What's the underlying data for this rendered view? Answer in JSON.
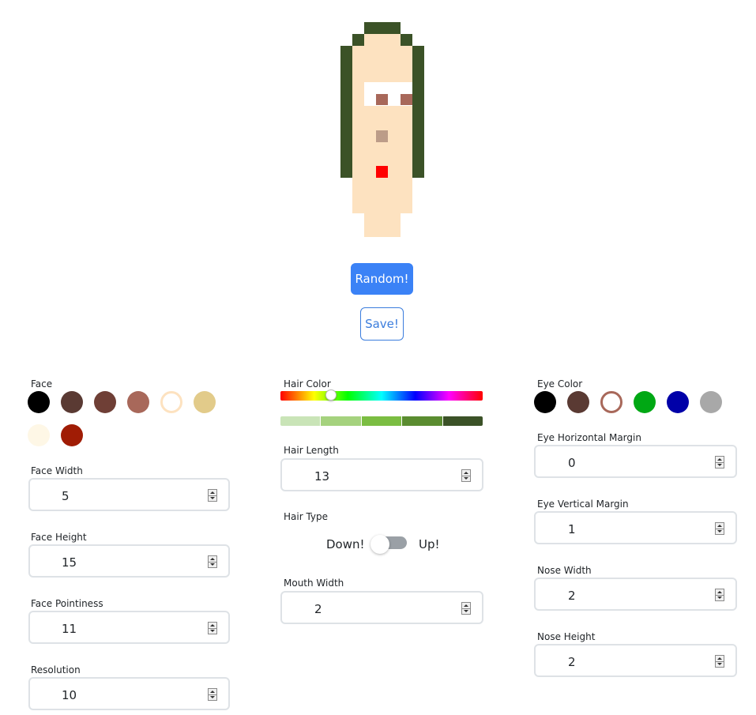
{
  "buttons": {
    "random_label": "Random!",
    "save_label": "Save!"
  },
  "face": {
    "label": "Face",
    "swatches": [
      "#000000",
      "#5a3a33",
      "#6f3f36",
      "#a8685a",
      "#fde2c0",
      "#e2cb8a",
      "#fef7e6",
      "#a01c05"
    ],
    "selected_swatch": "#fde2c0",
    "width": {
      "label": "Face Width",
      "value": "5"
    },
    "height": {
      "label": "Face Height",
      "value": "15"
    },
    "pointiness": {
      "label": "Face Pointiness",
      "value": "11"
    },
    "resolution": {
      "label": "Resolution",
      "value": "10"
    }
  },
  "hair": {
    "color_label": "Hair Color",
    "hue_level": 0.25,
    "shades": [
      "#c9e4b7",
      "#a5d27e",
      "#7bbd42",
      "#5a8c30",
      "#3b5227"
    ],
    "length": {
      "label": "Hair Length",
      "value": "13"
    },
    "type": {
      "label": "Hair Type",
      "off_label": "Down!",
      "on_label": "Up!",
      "is_up": false
    }
  },
  "mouth": {
    "width": {
      "label": "Mouth Width",
      "value": "2"
    }
  },
  "eye": {
    "color_label": "Eye Color",
    "swatches": [
      "#000000",
      "#5a3a33",
      "#a8685a",
      "#00a814",
      "#0000a8",
      "#a8a8a8"
    ],
    "selected_swatch": "#a8685a",
    "horizontal_margin": {
      "label": "Eye Horizontal Margin",
      "value": "0"
    },
    "vertical_margin": {
      "label": "Eye Vertical Margin",
      "value": "1"
    }
  },
  "nose": {
    "width": {
      "label": "Nose Width",
      "value": "2"
    },
    "height": {
      "label": "Nose Height",
      "value": "2"
    }
  },
  "colors": {
    "hair": "#3b5227",
    "skin": "#fde2c0",
    "eye_white": "#ffffff",
    "pupil": "#a8685a",
    "nose": "#bc9c88",
    "mouth": "#ff0000",
    "accent": "#3b82f6"
  }
}
